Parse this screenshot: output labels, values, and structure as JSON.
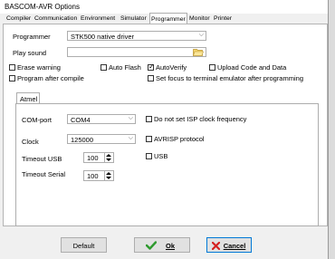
{
  "window": {
    "title": "BASCOM-AVR Options"
  },
  "tabs": [
    {
      "label": "Compiler"
    },
    {
      "label": "Communication"
    },
    {
      "label": "Environment"
    },
    {
      "label": "Simulator"
    },
    {
      "label": "Programmer"
    },
    {
      "label": "Monitor"
    },
    {
      "label": "Printer"
    }
  ],
  "programmer": {
    "label": "Programmer",
    "value": "STK500 native driver",
    "play_sound_label": "Play sound",
    "play_sound_value": ""
  },
  "options": {
    "erase_warning": {
      "label": "Erase warning",
      "checked": false
    },
    "auto_flash": {
      "label": "Auto Flash",
      "checked": false
    },
    "auto_verify": {
      "label": "AutoVerify",
      "checked": true
    },
    "upload_code": {
      "label": "Upload Code and Data",
      "checked": false
    },
    "program_after_compile": {
      "label": "Program after compile",
      "checked": false
    },
    "set_focus": {
      "label": "Set focus to terminal emulator after programming",
      "checked": false
    }
  },
  "atmel": {
    "tab_label": "Atmel",
    "com_port_label": "COM-port",
    "com_port_value": "COM4",
    "clock_label": "Clock",
    "clock_value": "125000",
    "timeout_usb_label": "Timeout USB",
    "timeout_usb_value": "100",
    "timeout_serial_label": "Timeout Serial",
    "timeout_serial_value": "100",
    "no_isp_clock": {
      "label": "Do not set ISP clock frequency",
      "checked": false
    },
    "avrisp": {
      "label": "AVRISP protocol",
      "checked": false
    },
    "usb": {
      "label": "USB",
      "checked": false
    }
  },
  "buttons": {
    "default": "Default",
    "ok": "Ok",
    "cancel": "Cancel"
  },
  "colors": {
    "ok_check": "#2e9a2e",
    "cancel_x": "#d42020",
    "focus_border": "#0078d7"
  }
}
